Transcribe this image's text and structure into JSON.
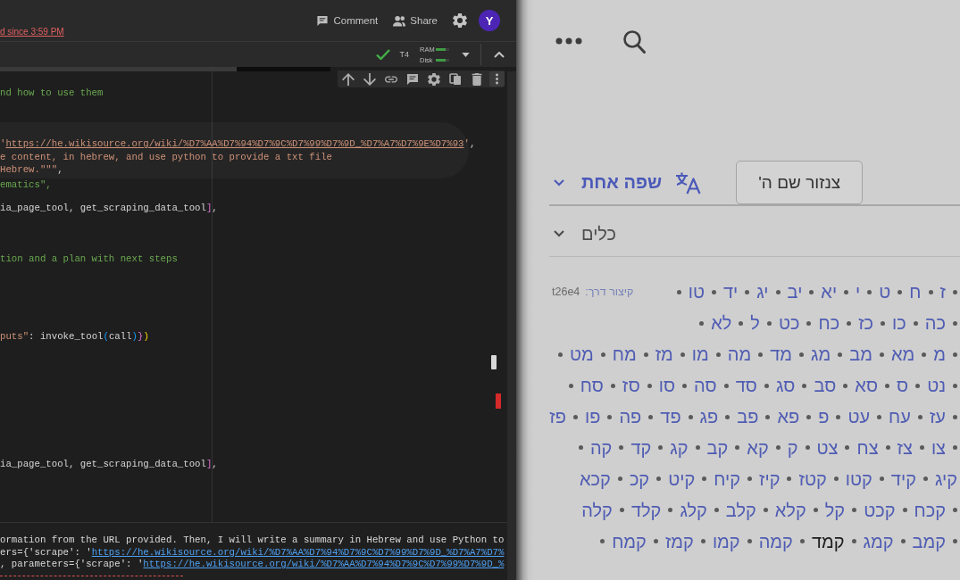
{
  "notebook": {
    "save_status": "d since 3:59 PM",
    "comment_label": "Comment",
    "share_label": "Share",
    "avatar": "Y",
    "runtime": {
      "connected": true,
      "type": "T4",
      "meters": [
        {
          "label": "RAM",
          "level": 0.7
        },
        {
          "label": "Disk",
          "level": 0.7
        }
      ]
    },
    "code_blocks": [
      {
        "highlighted": false,
        "lines": [
          {
            "kind": "comment",
            "text": "nd how to use them"
          }
        ]
      },
      {
        "highlighted": true,
        "lines": [
          {
            "kind": "code",
            "text": "'https://he.wikisource.org/wiki/%D7%AA%D7%94%D7%9C%D7%99%D7%9D_%D7%A7%D7%9E%D7%93',"
          },
          {
            "kind": "string",
            "text": "e content, in hebrew, and use python to provide a txt file"
          },
          {
            "kind": "string",
            "text": "Hebrew.\"\"\","
          }
        ]
      },
      {
        "highlighted": false,
        "lines": [
          {
            "kind": "comment",
            "text": "ematics\","
          }
        ]
      },
      {
        "highlighted": false,
        "lines": [
          {
            "kind": "code",
            "text": "ia_page_tool, get_scraping_data_tool],"
          }
        ]
      },
      {
        "highlighted": false,
        "lines": [
          {
            "kind": "comment",
            "text": "tion and a plan with next steps"
          }
        ]
      },
      {
        "highlighted": false,
        "lines": [
          {
            "kind": "string",
            "text": "puts\": invoke_tool(call)})"
          }
        ]
      },
      {
        "highlighted": false,
        "lines": [
          {
            "kind": "code",
            "text": "ia_page_tool, get_scraping_data_tool],"
          }
        ]
      }
    ],
    "output_lines": [
      "ormation from the URL provided. Then, I will write a summary in Hebrew and use Python to",
      "ers={'scrape': 'https://he.wikisource.org/wiki/%D7%AA%D7%94%D7%9C%D7%99%D7%9D_%D7%A7%D7%",
      ", parameters={'scrape': 'https://he.wikisource.org/wiki/%D7%AA%D7%94%D7%9C%D7%99%D7%9D_%"
    ]
  },
  "wiki": {
    "censor_button": "צנזור שם ה'",
    "language_button": "שפה אחת",
    "tools_menu": "כלים",
    "chapter_rows": [
      {
        "bullet_start": true,
        "bullet_end": true,
        "shortcut": {
          "label": "קיצור דרך:",
          "value": "t26e4"
        },
        "chapters": [
          {
            "label": "ז",
            "selected": false
          },
          {
            "label": "ח",
            "selected": false
          },
          {
            "label": "ט",
            "selected": false
          },
          {
            "label": "י",
            "selected": false
          },
          {
            "label": "יא",
            "selected": false
          },
          {
            "label": "יב",
            "selected": false
          },
          {
            "label": "יג",
            "selected": false
          },
          {
            "label": "יד",
            "selected": false
          },
          {
            "label": "טו",
            "selected": false
          }
        ]
      },
      {
        "bullet_start": true,
        "bullet_end": true,
        "chapters": [
          {
            "label": "כה",
            "selected": false
          },
          {
            "label": "כו",
            "selected": false
          },
          {
            "label": "כז",
            "selected": false
          },
          {
            "label": "כח",
            "selected": false
          },
          {
            "label": "כט",
            "selected": false
          },
          {
            "label": "ל",
            "selected": false
          },
          {
            "label": "לא",
            "selected": false
          }
        ]
      },
      {
        "bullet_start": true,
        "bullet_end": true,
        "chapters": [
          {
            "label": "מ",
            "selected": false
          },
          {
            "label": "מא",
            "selected": false
          },
          {
            "label": "מב",
            "selected": false
          },
          {
            "label": "מג",
            "selected": false
          },
          {
            "label": "מד",
            "selected": false
          },
          {
            "label": "מה",
            "selected": false
          },
          {
            "label": "מו",
            "selected": false
          },
          {
            "label": "מז",
            "selected": false
          },
          {
            "label": "מח",
            "selected": false
          },
          {
            "label": "מט",
            "selected": false
          }
        ]
      },
      {
        "bullet_start": true,
        "bullet_end": true,
        "chapters": [
          {
            "label": "נט",
            "selected": false
          },
          {
            "label": "ס",
            "selected": false
          },
          {
            "label": "סא",
            "selected": false
          },
          {
            "label": "סב",
            "selected": false
          },
          {
            "label": "סג",
            "selected": false
          },
          {
            "label": "סד",
            "selected": false
          },
          {
            "label": "סה",
            "selected": false
          },
          {
            "label": "סו",
            "selected": false
          },
          {
            "label": "סז",
            "selected": false
          },
          {
            "label": "סח",
            "selected": false
          }
        ]
      },
      {
        "bullet_start": true,
        "bullet_end": false,
        "chapters": [
          {
            "label": "עז",
            "selected": false
          },
          {
            "label": "עח",
            "selected": false
          },
          {
            "label": "עט",
            "selected": false
          },
          {
            "label": "פ",
            "selected": false
          },
          {
            "label": "פא",
            "selected": false
          },
          {
            "label": "פב",
            "selected": false
          },
          {
            "label": "פג",
            "selected": false
          },
          {
            "label": "פד",
            "selected": false
          },
          {
            "label": "פה",
            "selected": false
          },
          {
            "label": "פו",
            "selected": false
          },
          {
            "label": "פז",
            "selected": false
          }
        ]
      },
      {
        "bullet_start": true,
        "bullet_end": true,
        "chapters": [
          {
            "label": "צו",
            "selected": false
          },
          {
            "label": "צז",
            "selected": false
          },
          {
            "label": "צח",
            "selected": false
          },
          {
            "label": "צט",
            "selected": false
          },
          {
            "label": "ק",
            "selected": false
          },
          {
            "label": "קא",
            "selected": false
          },
          {
            "label": "קב",
            "selected": false
          },
          {
            "label": "קג",
            "selected": false
          },
          {
            "label": "קד",
            "selected": false
          },
          {
            "label": "קה",
            "selected": false
          }
        ]
      },
      {
        "bullet_start": false,
        "bullet_end": false,
        "chapters": [
          {
            "label": "קיג",
            "selected": false
          },
          {
            "label": "קיד",
            "selected": false
          },
          {
            "label": "קטו",
            "selected": false
          },
          {
            "label": "קטז",
            "selected": false
          },
          {
            "label": "קיז",
            "selected": false
          },
          {
            "label": "קיח",
            "selected": false
          },
          {
            "label": "קיט",
            "selected": false
          },
          {
            "label": "קכ",
            "selected": false
          },
          {
            "label": "קכא",
            "selected": false
          }
        ]
      },
      {
        "bullet_start": true,
        "bullet_end": false,
        "chapters": [
          {
            "label": "קכח",
            "selected": false
          },
          {
            "label": "קכט",
            "selected": false
          },
          {
            "label": "קל",
            "selected": false
          },
          {
            "label": "קלא",
            "selected": false
          },
          {
            "label": "קלב",
            "selected": false
          },
          {
            "label": "קלג",
            "selected": false
          },
          {
            "label": "קלד",
            "selected": false
          },
          {
            "label": "קלה",
            "selected": false
          }
        ]
      },
      {
        "bullet_start": true,
        "bullet_end": true,
        "chapters": [
          {
            "label": "קמב",
            "selected": false
          },
          {
            "label": "קמג",
            "selected": false
          },
          {
            "label": "קמד",
            "selected": true
          },
          {
            "label": "קמה",
            "selected": false
          },
          {
            "label": "קמו",
            "selected": false
          },
          {
            "label": "קמז",
            "selected": false
          },
          {
            "label": "קמח",
            "selected": false
          }
        ]
      }
    ]
  }
}
